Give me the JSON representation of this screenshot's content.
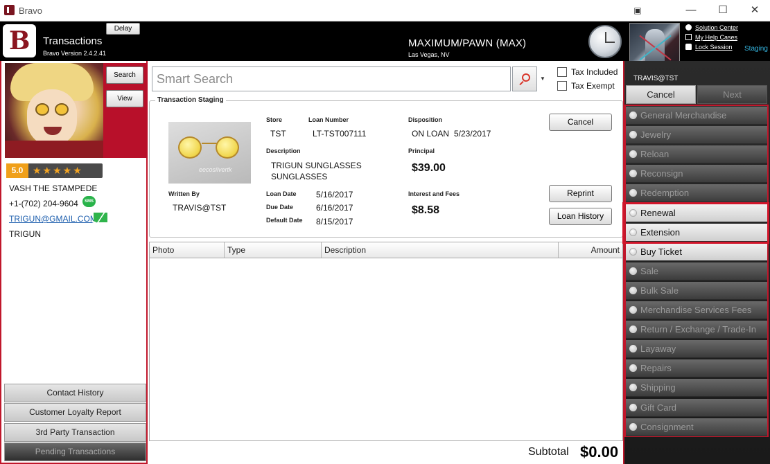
{
  "window": {
    "title": "Bravo"
  },
  "header": {
    "app_title": "Transactions",
    "version": "Bravo Version 2.4.2.41",
    "delay_label": "Delay",
    "store_name": "MAXIMUM/PAWN (MAX)",
    "store_location": "Las Vegas, NV",
    "links": [
      "Solution Center",
      "My Help Cases",
      "Lock Session"
    ],
    "environment": "Staging"
  },
  "customer": {
    "search_label": "Search",
    "view_label": "View",
    "rating": "5.0",
    "stars": "★★★★★",
    "name": "VASH THE STAMPEDE",
    "phone": "+1-(702) 204-9604",
    "sms_badge": "SMS",
    "email": "TRIGUN@GMAIL.COM",
    "group": "TRIGUN"
  },
  "left_actions": [
    "Contact History",
    "Customer Loyalty Report",
    "3rd Party Transaction",
    "Pending Transactions"
  ],
  "search": {
    "placeholder": "Smart Search",
    "tax_included": "Tax Included",
    "tax_exempt": "Tax Exempt"
  },
  "staging": {
    "title": "Transaction Staging",
    "photo_watermark": "eecosilvertk",
    "store_label": "Store",
    "store": "TST",
    "loan_number_label": "Loan Number",
    "loan_number": "LT-TST007111",
    "disposition_label": "Disposition",
    "disposition": "ON LOAN",
    "disposition_date": "5/23/2017",
    "description_label": "Description",
    "description_1": "TRIGUN SUNGLASSES",
    "description_2": "SUNGLASSES",
    "principal_label": "Principal",
    "principal": "$39.00",
    "written_by_label": "Written By",
    "written_by": "TRAVIS@TST",
    "loan_date_label": "Loan Date",
    "loan_date": "5/16/2017",
    "due_date_label": "Due Date",
    "due_date": "6/16/2017",
    "default_date_label": "Default Date",
    "default_date": "8/15/2017",
    "interest_label": "Interest and Fees",
    "interest": "$8.58",
    "cancel_label": "Cancel",
    "reprint_label": "Reprint",
    "loan_history_label": "Loan History"
  },
  "grid": {
    "columns": [
      "Photo",
      "Type",
      "Description",
      "Amount"
    ]
  },
  "subtotal": {
    "label": "Subtotal",
    "value": "$0.00"
  },
  "user": {
    "name": "TRAVIS@TST"
  },
  "nav": {
    "cancel_label": "Cancel",
    "next_label": "Next"
  },
  "menu": [
    {
      "label": "General Merchandise",
      "active": false
    },
    {
      "label": "Jewelry",
      "active": false
    },
    {
      "label": "Reloan",
      "active": false
    },
    {
      "label": "Reconsign",
      "active": false
    },
    {
      "label": "Redemption",
      "active": false
    },
    {
      "label": "Renewal",
      "active": true
    },
    {
      "label": "Extension",
      "active": true
    },
    {
      "label": "Buy Ticket",
      "active": true
    },
    {
      "label": "Sale",
      "active": false
    },
    {
      "label": "Bulk Sale",
      "active": false
    },
    {
      "label": "Merchandise Services Fees",
      "active": false
    },
    {
      "label": "Return / Exchange / Trade-In",
      "active": false
    },
    {
      "label": "Layaway",
      "active": false
    },
    {
      "label": "Repairs",
      "active": false
    },
    {
      "label": "Shipping",
      "active": false
    },
    {
      "label": "Gift Card",
      "active": false
    },
    {
      "label": "Consignment",
      "active": false
    }
  ],
  "colors": {
    "accent_red": "#c0172b",
    "header_black": "#000000",
    "staging_blue": "#35b6e0",
    "star_gold": "#f5a623"
  }
}
